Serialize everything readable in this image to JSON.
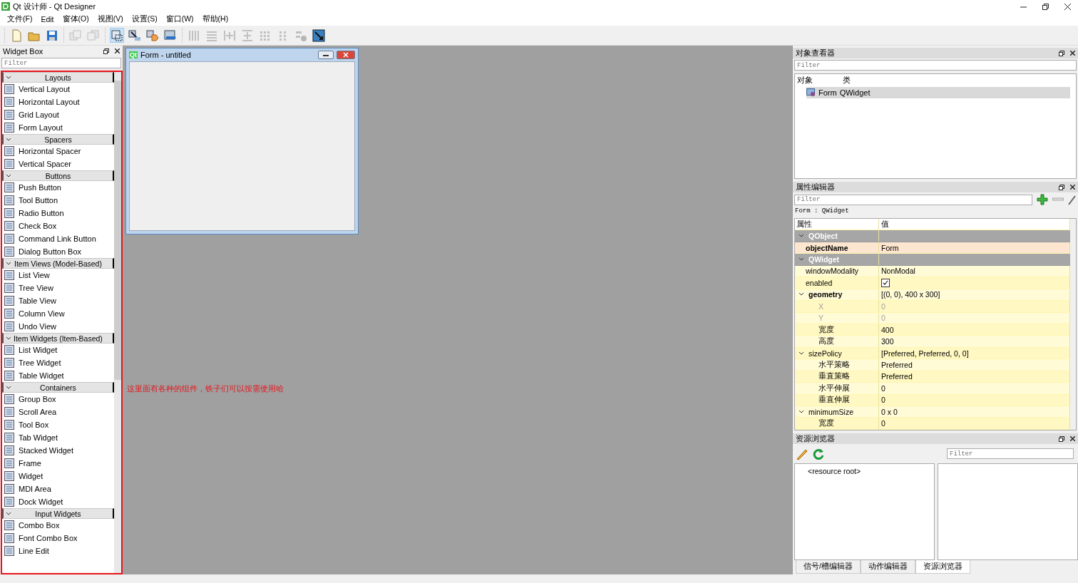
{
  "window": {
    "title": "Qt 设计师 - Qt Designer"
  },
  "menu": [
    "文件(F)",
    "Edit",
    "窗体(O)",
    "视图(V)",
    "设置(S)",
    "窗口(W)",
    "帮助(H)"
  ],
  "toolbar": [
    [
      {
        "kind": "new",
        "selected": false,
        "disabled": false
      },
      {
        "kind": "open",
        "selected": false,
        "disabled": false
      },
      {
        "kind": "save",
        "selected": false,
        "disabled": false
      }
    ],
    [
      {
        "kind": "back",
        "selected": false,
        "disabled": true
      },
      {
        "kind": "front",
        "selected": false,
        "disabled": true
      }
    ],
    [
      {
        "kind": "edit-widgets",
        "selected": true,
        "disabled": false
      },
      {
        "kind": "signals",
        "selected": false,
        "disabled": false
      },
      {
        "kind": "buddy",
        "selected": false,
        "disabled": false
      },
      {
        "kind": "tab-order",
        "selected": false,
        "disabled": false
      }
    ],
    [
      {
        "kind": "hbox",
        "selected": false,
        "disabled": true
      },
      {
        "kind": "vbox",
        "selected": false,
        "disabled": true
      },
      {
        "kind": "hsplit",
        "selected": false,
        "disabled": true
      },
      {
        "kind": "vsplit",
        "selected": false,
        "disabled": true
      },
      {
        "kind": "grid",
        "selected": false,
        "disabled": true
      },
      {
        "kind": "form",
        "selected": false,
        "disabled": true
      },
      {
        "kind": "break",
        "selected": false,
        "disabled": true
      },
      {
        "kind": "adjust",
        "selected": false,
        "disabled": false
      }
    ]
  ],
  "widget_box": {
    "title": "Widget Box",
    "filter_placeholder": "Filter",
    "groups": [
      {
        "name": "Layouts",
        "expanded": true,
        "items": [
          "Vertical Layout",
          "Horizontal Layout",
          "Grid Layout",
          "Form Layout"
        ]
      },
      {
        "name": "Spacers",
        "expanded": true,
        "items": [
          "Horizontal Spacer",
          "Vertical Spacer"
        ]
      },
      {
        "name": "Buttons",
        "expanded": true,
        "items": [
          "Push Button",
          "Tool Button",
          "Radio Button",
          "Check Box",
          "Command Link Button",
          "Dialog Button Box"
        ]
      },
      {
        "name": "Item Views (Model-Based)",
        "expanded": true,
        "items": [
          "List View",
          "Tree View",
          "Table View",
          "Column View",
          "Undo View"
        ]
      },
      {
        "name": "Item Widgets (Item-Based)",
        "expanded": true,
        "items": [
          "List Widget",
          "Tree Widget",
          "Table Widget"
        ]
      },
      {
        "name": "Containers",
        "expanded": true,
        "items": [
          "Group Box",
          "Scroll Area",
          "Tool Box",
          "Tab Widget",
          "Stacked Widget",
          "Frame",
          "Widget",
          "MDI Area",
          "Dock Widget"
        ]
      },
      {
        "name": "Input Widgets",
        "expanded": true,
        "items": [
          "Combo Box",
          "Font Combo Box",
          "Line Edit"
        ]
      }
    ]
  },
  "form_window": {
    "badge": "Qt",
    "title": "Form - untitled"
  },
  "annotation": "这里面有各种的组件，铁子们可以按需使用哈",
  "object_inspector": {
    "title": "对象查看器",
    "filter_placeholder": "Filter",
    "columns": [
      "对象",
      "类"
    ],
    "rows": [
      {
        "object": "Form",
        "class": "QWidget",
        "selected": true
      }
    ]
  },
  "property_editor": {
    "title": "属性编辑器",
    "filter_placeholder": "Filter",
    "context": "Form : QWidget",
    "columns": [
      "属性",
      "值"
    ],
    "groups": [
      {
        "name": "QObject",
        "expanded": true,
        "properties": [
          {
            "name": "objectName",
            "value": "Form",
            "modified": true,
            "selected": true
          }
        ]
      },
      {
        "name": "QWidget",
        "expanded": true,
        "properties": [
          {
            "name": "windowModality",
            "value": "NonModal",
            "modified": false,
            "selected": false
          },
          {
            "name": "enabled",
            "kind": "checkbox",
            "checked": true,
            "modified": false,
            "selected": false
          },
          {
            "name": "geometry",
            "value": "[(0, 0), 400 x 300]",
            "modified": true,
            "selected": false,
            "expanded": true,
            "children": [
              {
                "name": "X",
                "value": "0",
                "disabled": true
              },
              {
                "name": "Y",
                "value": "0",
                "disabled": true
              },
              {
                "name": "宽度",
                "value": "400",
                "disabled": false
              },
              {
                "name": "高度",
                "value": "300",
                "disabled": false
              }
            ]
          },
          {
            "name": "sizePolicy",
            "value": "[Preferred, Preferred, 0, 0]",
            "modified": false,
            "selected": false,
            "expanded": true,
            "children": [
              {
                "name": "水平策略",
                "value": "Preferred",
                "disabled": false
              },
              {
                "name": "垂直策略",
                "value": "Preferred",
                "disabled": false
              },
              {
                "name": "水平伸展",
                "value": "0",
                "disabled": false
              },
              {
                "name": "垂直伸展",
                "value": "0",
                "disabled": false
              }
            ]
          },
          {
            "name": "minimumSize",
            "value": "0 x 0",
            "modified": false,
            "selected": false,
            "expanded": true,
            "children": [
              {
                "name": "宽度",
                "value": "0",
                "disabled": false
              }
            ]
          }
        ]
      }
    ]
  },
  "resource_browser": {
    "title": "资源浏览器",
    "filter_placeholder": "Filter",
    "tree": [
      "<resource root>"
    ]
  },
  "bottom_tabs": [
    {
      "label": "信号/槽编辑器",
      "selected": false
    },
    {
      "label": "动作编辑器",
      "selected": false
    },
    {
      "label": "资源浏览器",
      "selected": true
    }
  ]
}
